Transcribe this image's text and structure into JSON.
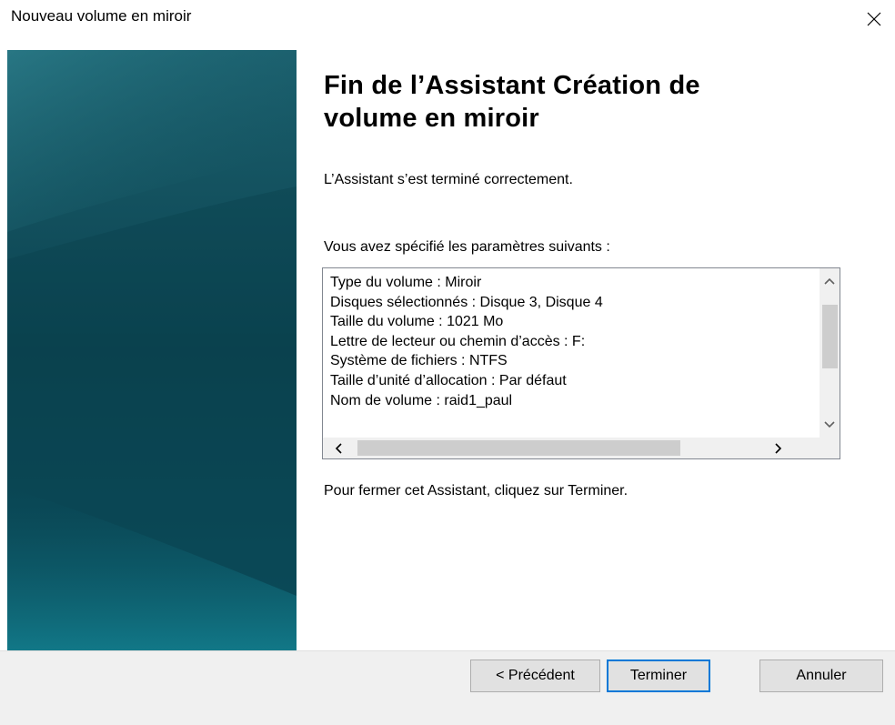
{
  "window": {
    "title": "Nouveau volume en miroir",
    "close_icon": "close-icon"
  },
  "banner": {
    "colors": [
      "#1f6b78",
      "#0d4a57",
      "#0a3f4e",
      "#12707e"
    ]
  },
  "main": {
    "heading": "Fin de l’Assistant Création de volume en miroir",
    "success_text": "L’Assistant s’est terminé correctement.",
    "params_label": "Vous avez spécifié les paramètres suivants :",
    "params": [
      "Type du volume : Miroir",
      "Disques sélectionnés : Disque 3, Disque 4",
      "Taille du volume : 1021 Mo",
      "Lettre de lecteur ou chemin d’accès : F:",
      "Système de fichiers : NTFS",
      "Taille d’unité d’allocation : Par défaut",
      "Nom de volume : raid1_paul"
    ],
    "closing_text": "Pour fermer cet Assistant, cliquez sur Terminer."
  },
  "buttons": {
    "previous": "< Précédent",
    "finish": "Terminer",
    "cancel": "Annuler"
  },
  "colors": {
    "focus_border": "#0078d7",
    "footer_bg": "#f0f0f0",
    "button_bg": "#e1e1e1"
  }
}
